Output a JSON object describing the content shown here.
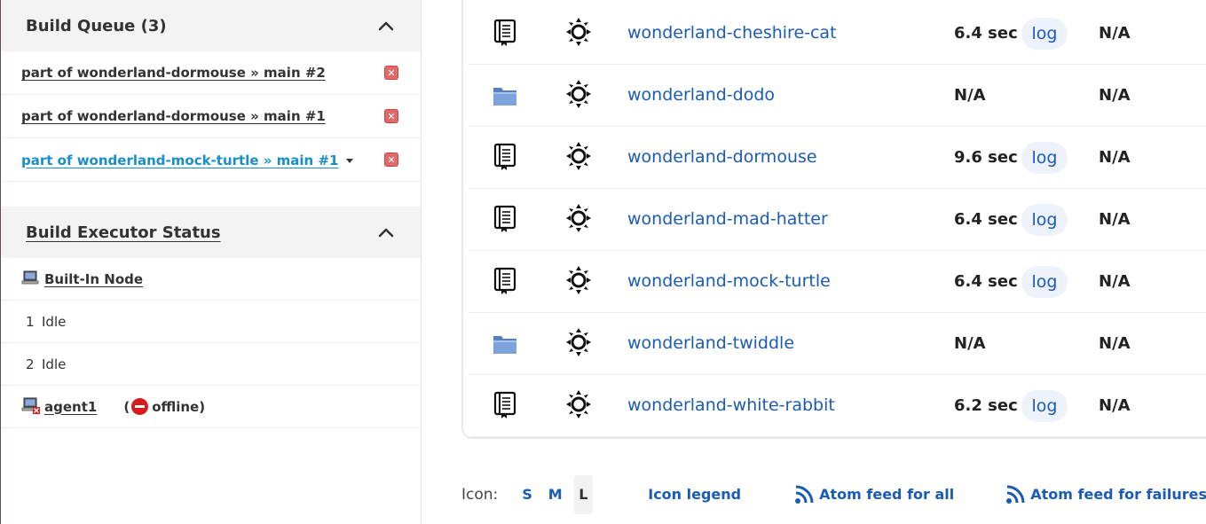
{
  "build_queue": {
    "title": "Build Queue (3)",
    "items": [
      {
        "label": "part of wonderland-dormouse » main #2"
      },
      {
        "label": "part of wonderland-dormouse » main #1"
      },
      {
        "label": "part of wonderland-mock-turtle » main #1"
      }
    ],
    "cancel_glyph": "✕"
  },
  "executor_status": {
    "title": "Build Executor Status",
    "built_in_node": "Built-In Node",
    "executors": [
      {
        "num": "1",
        "state": "Idle"
      },
      {
        "num": "2",
        "state": "Idle"
      }
    ],
    "agent": {
      "name": "agent1",
      "open_paren": "(",
      "status": "offline)"
    }
  },
  "jobs": [
    {
      "name": "wonderland-cheshire-cat",
      "type": "pipeline-icon",
      "duration": "6.4 sec",
      "log": "log",
      "last": "N/A"
    },
    {
      "name": "wonderland-dodo",
      "type": "folder-icon",
      "duration": "N/A",
      "log": "",
      "last": "N/A"
    },
    {
      "name": "wonderland-dormouse",
      "type": "pipeline-icon",
      "duration": "9.6 sec",
      "log": "log",
      "last": "N/A"
    },
    {
      "name": "wonderland-mad-hatter",
      "type": "pipeline-icon",
      "duration": "6.4 sec",
      "log": "log",
      "last": "N/A"
    },
    {
      "name": "wonderland-mock-turtle",
      "type": "pipeline-icon",
      "duration": "6.4 sec",
      "log": "log",
      "last": "N/A"
    },
    {
      "name": "wonderland-twiddle",
      "type": "folder-icon",
      "duration": "N/A",
      "log": "",
      "last": "N/A"
    },
    {
      "name": "wonderland-white-rabbit",
      "type": "pipeline-icon",
      "duration": "6.2 sec",
      "log": "log",
      "last": "N/A"
    }
  ],
  "footer": {
    "icon_label": "Icon:",
    "sizes": [
      "S",
      "M",
      "L"
    ],
    "selected_size": "L",
    "icon_legend": "Icon legend",
    "atom_all": "Atom feed for all",
    "atom_failures": "Atom feed for failures"
  },
  "colors": {
    "link": "#1a5bb5",
    "active_queue_link": "#1a8ec8",
    "offline_red": "#d61b1b"
  }
}
